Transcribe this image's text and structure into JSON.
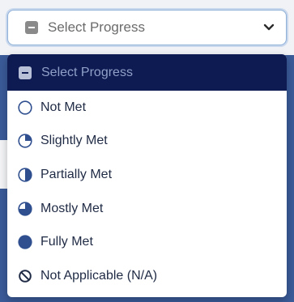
{
  "select": {
    "value": "Select Progress",
    "icon": "minus-square-icon",
    "chevron": "chevron-down-icon"
  },
  "menu": {
    "options": [
      {
        "label": "Select Progress",
        "icon": "minus-square-icon",
        "selected": true
      },
      {
        "label": "Not Met",
        "icon": "empty-circle-icon"
      },
      {
        "label": "Slightly Met",
        "icon": "quarter-circle-icon"
      },
      {
        "label": "Partially Met",
        "icon": "half-circle-icon"
      },
      {
        "label": "Mostly Met",
        "icon": "three-quarter-circle-icon"
      },
      {
        "label": "Fully Met",
        "icon": "full-circle-icon"
      },
      {
        "label": "Not Applicable (N/A)",
        "icon": "prohibited-icon"
      }
    ]
  },
  "colors": {
    "accent": "#3a5a98",
    "selected_bg": "#0e1b52",
    "icon_fill": "#2f4f8f"
  }
}
